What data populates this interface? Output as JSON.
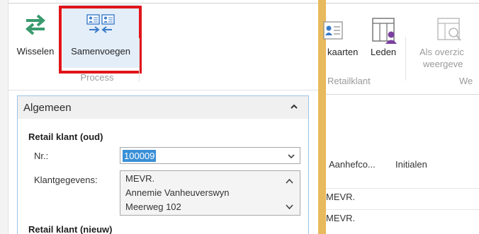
{
  "dialog": {
    "ribbon": {
      "wisselen_label": "Wisselen",
      "samenvoegen_label": "Samenvoegen",
      "group_label": "Process"
    },
    "panel": {
      "title": "Algemeen",
      "section_old": "Retail klant (oud)",
      "nr_label": "Nr.:",
      "nr_value": "100009",
      "klantgegevens_label": "Klantgegevens:",
      "klantgegevens_lines": [
        "MEVR.",
        "Annemie Vanheuverswyn",
        "Meerweg 102"
      ],
      "section_new": "Retail klant (nieuw)"
    }
  },
  "background": {
    "ribbon": {
      "kaarten_label": "kaarten",
      "leden_label": "Leden",
      "overzicht_line1": "Als overzic",
      "overzicht_line2": "weergeve",
      "group_retailklant": "Retailklant",
      "group_we": "We"
    },
    "table": {
      "columns": [
        "Aanhefco...",
        "Initialen"
      ],
      "rows": [
        {
          "aanhef": "MEVR."
        },
        {
          "aanhef": "MEVR."
        }
      ]
    }
  },
  "colors": {
    "highlight": "#e0151a",
    "selected_button_bg": "#e4eef9",
    "selection": "#3a8fd6",
    "divider": "#e8ba5e",
    "panel_border": "#9cc3e8",
    "swap_icon": "#3a9a6e",
    "merge_icon": "#3a7bc8"
  },
  "icons": {
    "wisselen": "swap-arrows-icon",
    "samenvoegen": "merge-contacts-icon",
    "collapse": "chevron-up-icon",
    "dropdown": "chevron-down-icon"
  }
}
